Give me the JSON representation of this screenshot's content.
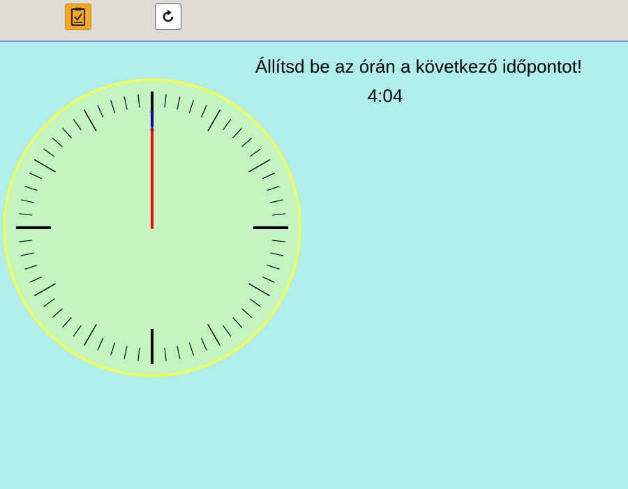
{
  "toolbar": {
    "check_icon": "clipboard-check-icon",
    "reset_icon": "reset-arrow-icon",
    "accent_color": "#f5a623",
    "background_color": "#dfdbd5",
    "border_color": "#8c8cf0"
  },
  "task": {
    "prompt": "Állítsd be az órán a következő időpontot!",
    "target_time": "4:04"
  },
  "clock": {
    "hour_hand_value": 0,
    "minute_hand_value": 0,
    "face_color": "#c2f4c2",
    "rim_color": "#ffff33",
    "hour_hand_color": "#0000cc",
    "minute_hand_color": "#ff0000"
  }
}
